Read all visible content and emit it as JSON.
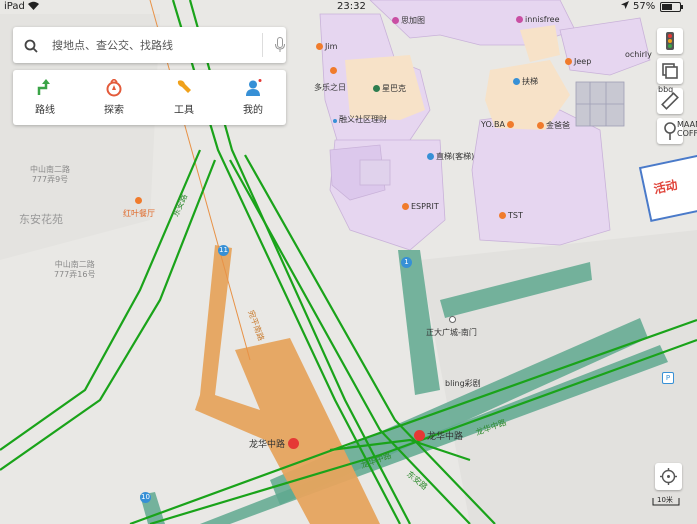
{
  "status_bar": {
    "device": "iPad",
    "time": "23:32",
    "battery": "57%"
  },
  "search": {
    "placeholder": "搜地点、查公交、找路线"
  },
  "quick_actions": [
    {
      "label": "路线",
      "icon": "route-icon",
      "color": "#3aa447"
    },
    {
      "label": "探索",
      "icon": "explore-icon",
      "color": "#e35a3a"
    },
    {
      "label": "工具",
      "icon": "wrench-icon",
      "color": "#f0a11b"
    },
    {
      "label": "我的",
      "icon": "user-icon",
      "color": "#3790d6"
    }
  ],
  "map_pois": {
    "sijia": "思加图",
    "innisfree": "innisfree",
    "jim": "Jim",
    "jeep": "Jeep",
    "ochirly": "ochirly",
    "bbq": "bbq",
    "maan_1": "MAAN",
    "maan_2": "COFF",
    "duole": "多乐之日",
    "starbucks": "星巴克",
    "escalator": "扶梯",
    "rongyi": "融义社区理财",
    "yoba": "YO.BA",
    "jinyeye": "金爸爸",
    "elevator": "直梯(客梯)",
    "esprit": "ESPRIT",
    "tst": "TST",
    "hongye": "红叶餐厅",
    "zhengda": "正大广城-南门",
    "bling": "bling彩剧",
    "longhua_station_1": "龙华中路",
    "longhua_station_2": "龙华中路"
  },
  "map_places": {
    "zhongshan_9": [
      "中山南二路",
      "777弄9号"
    ],
    "dongan": "东安花苑",
    "zhongshan_16": [
      "中山南二路",
      "777弄16号"
    ]
  },
  "map_roads": {
    "road_a": "东安路",
    "road_b": "宛平南路",
    "road_c": "龙华中路",
    "road_d": "龙华中路",
    "road_e": "东安路"
  },
  "metro": {
    "line_11": "11",
    "line_1": "1",
    "line_10": "10"
  },
  "scale_label": "10米",
  "banner_text": "活动",
  "colors": {
    "route_green": "#1aa31a",
    "building_purple": "#e6d6f0",
    "building_peach": "#f7e2c8",
    "metro_orange": "#e6a45e",
    "passage_teal": "#5fa88f"
  }
}
